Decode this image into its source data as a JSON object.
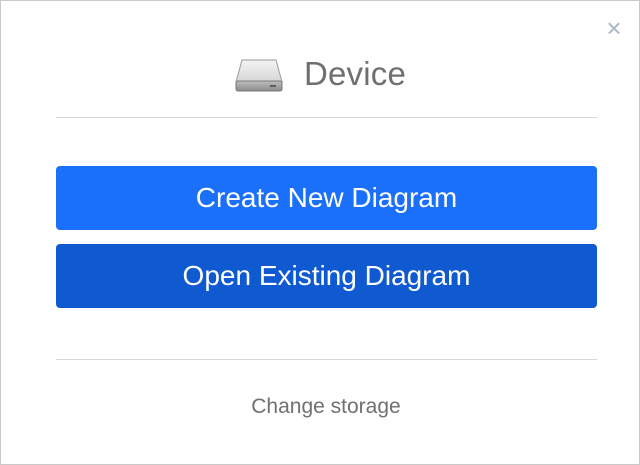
{
  "dialog": {
    "close_glyph": "×",
    "title": "Device",
    "icon": "hard-drive-icon",
    "buttons": {
      "create": "Create New Diagram",
      "open": "Open Existing Diagram"
    },
    "footer_link": "Change storage"
  },
  "colors": {
    "primary_button": "#1a6ffb",
    "secondary_button": "#0f59d1",
    "title_text": "#6f6f6f",
    "close_icon": "#a9b7c6",
    "divider": "#d7d7d7"
  }
}
